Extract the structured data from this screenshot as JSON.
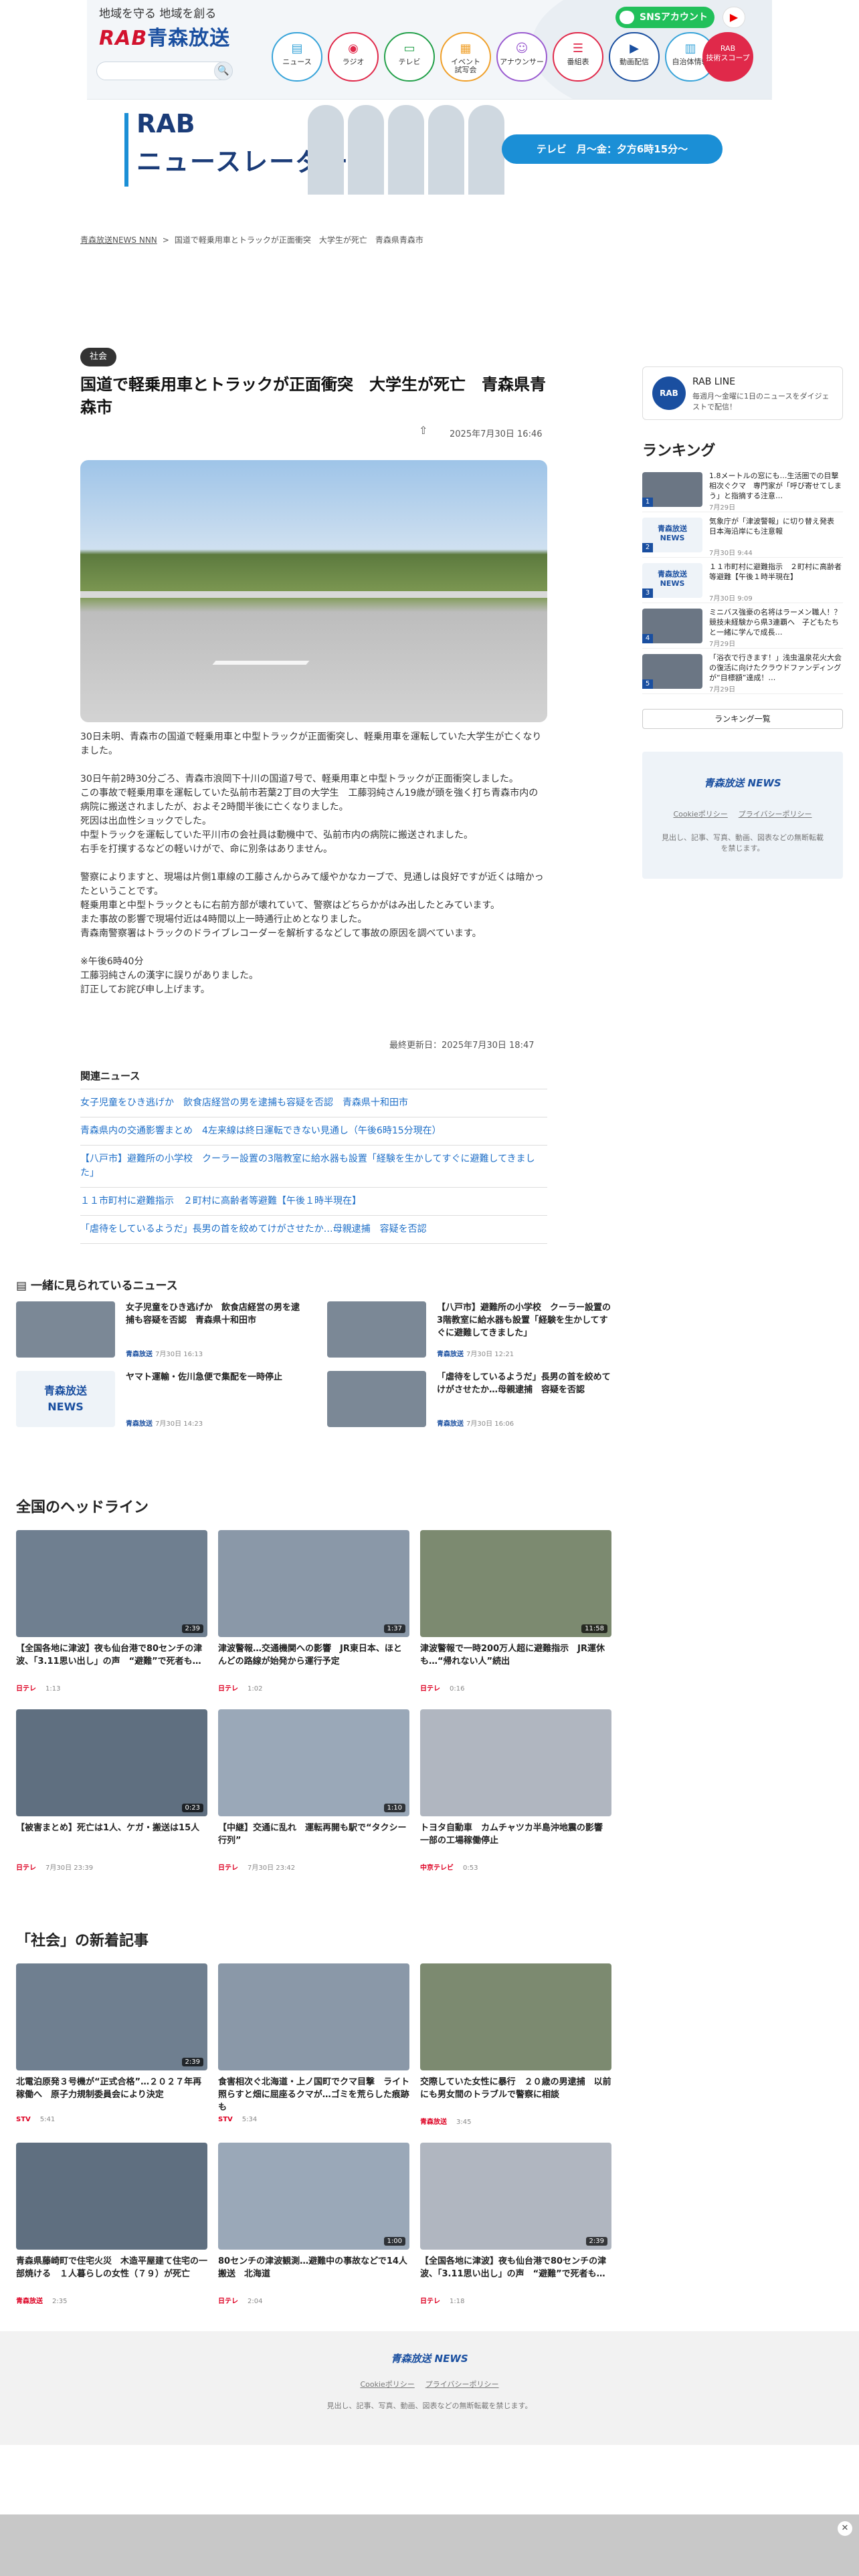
{
  "header": {
    "tagline": "地域を守る 地域を創る",
    "logo_rab": "RAB",
    "logo_name": "青森放送",
    "search_icon": "search-icon",
    "sns_label": "SNSアカウント",
    "nav": [
      {
        "label": "ニュース",
        "icon": "newspaper-icon"
      },
      {
        "label": "ラジオ",
        "icon": "radio-icon"
      },
      {
        "label": "テレビ",
        "icon": "tv-icon"
      },
      {
        "label": "イベント\n試写会",
        "icon": "calendar-icon"
      },
      {
        "label": "アナウンサー",
        "icon": "person-icon"
      },
      {
        "label": "番組表",
        "icon": "list-icon"
      },
      {
        "label": "動画配信",
        "icon": "video-icon"
      },
      {
        "label": "自治体情報",
        "icon": "building-icon"
      }
    ],
    "nav_special": "RAB\n技術スコープ"
  },
  "banner": {
    "line1": "RAB",
    "line2": "ニュースレーダー",
    "pill": "テレビ　月〜金：夕方6時15分〜"
  },
  "breadcrumb": [
    "青森放送NEWS NNN",
    "国道で軽乗用車とトラックが正面衝突　大学生が死亡　青森県青森市"
  ],
  "article": {
    "category": "社会",
    "title": "国道で軽乗用車とトラックが正面衝突　大学生が死亡　青森県青森市",
    "date": "2025年7月30日 16:46",
    "paragraphs": [
      "30日未明、青森市の国道で軽乗用車と中型トラックが正面衝突し、軽乗用車を運転していた大学生が亡くなりました。",
      "30日午前2時30分ごろ、青森市浪岡下十川の国道7号で、軽乗用車と中型トラックが正面衝突しました。\nこの事故で軽乗用車を運転していた弘前市若葉2丁目の大学生　工藤羽純さん19歳が頭を強く打ち青森市内の病院に搬送されましたが、およそ2時間半後に亡くなりました。\n死因は出血性ショックでした。\n中型トラックを運転していた平川市の会社員は動機中で、弘前市内の病院に搬送されました。\n右手を打撲するなどの軽いけがで、命に別条はありません。",
      "警察によりますと、現場は片側1車線の工藤さんからみて緩やかなカーブで、見通しは良好ですが近くは暗かったということです。\n軽乗用車と中型トラックともに右前方部が壊れていて、警察はどちらかがはみ出したとみています。\nまた事故の影響で現場付近は4時間以上一時通行止めとなりました。\n青森南警察署はトラックのドライブレコーダーを解析するなどして事故の原因を調べています。",
      "※午後6時40分\n工藤羽純さんの漢字に誤りがありました。\n訂正してお詫び申し上げます。"
    ],
    "updated": "最終更新日：2025年7月30日 18:47",
    "related_heading": "関連ニュース",
    "related": [
      "女子児童をひき逃げか　飲食店経営の男を逮捕も容疑を否認　青森県十和田市",
      "青森県内の交通影響まとめ　4左来線は終日運転できない見通し（午後6時15分現在）",
      "【八戸市】避難所の小学校　クーラー設置の3階教室に給水器も設置「経験を生かしてすぐに避難してきました」",
      "１１市町村に避難指示　２町村に高齢者等避難【午後１時半現在】",
      "「虐待をしているようだ」長男の首を絞めてけがさせたか…母親逮捕　容疑を否認"
    ]
  },
  "sidebar": {
    "line_title": "RAB LINE",
    "line_desc": "毎週月〜金曜に1日のニュースをダイジェストで配信！",
    "ranking_heading": "ランキング",
    "ranking": [
      {
        "title": "1.8メートルの窓にも…生活圏での目撃相次ぐクマ　専門家が「呼び寄せてしまう」と指摘する注意…",
        "date": "7月29日"
      },
      {
        "title": "気象庁が「津波警報」に切り替え発表　日本海沿岸にも注意報",
        "date": "7月30日 9:44"
      },
      {
        "title": "１１市町村に避難指示　２町村に高齢者等避難【午後１時半現在】",
        "date": "7月30日 9:09"
      },
      {
        "title": "ミニバス強豪の名将はラーメン職人！？競技未経験から県3連覇へ　子どもたちと一緒に学んで成長…",
        "date": "7月29日"
      },
      {
        "title": "「浴衣で行きます！」浅虫温泉花火大会の復活に向けたクラウドファンディングが“目標額”達成！…",
        "date": "7月29日"
      }
    ],
    "ranking_more": "ランキング一覧",
    "footer_logo": "青森放送 NEWS",
    "footer_links": [
      "Cookieポリシー",
      "プライバシーポリシー"
    ],
    "footer_copy": "見出し、記事、写真、動画、図表などの無断転載を禁じます。"
  },
  "also": {
    "heading": "一緒に見られているニュース",
    "items": [
      {
        "title": "女子児童をひき逃げか　飲食店経営の男を逮捕も容疑を否認　青森県十和田市",
        "src": "青森放送",
        "date": "7月30日 16:13"
      },
      {
        "title": "【八戸市】避難所の小学校　クーラー設置の3階教室に給水器も設置「経験を生かしてすぐに避難してきました」",
        "src": "青森放送",
        "date": "7月30日 12:21"
      },
      {
        "title": "ヤマト運輸・佐川急便で集配を一時停止",
        "src": "青森放送",
        "date": "7月30日 14:23"
      },
      {
        "title": "「虐待をしているようだ」長男の首を絞めてけがさせたか…母親逮捕　容疑を否認",
        "src": "青森放送",
        "date": "7月30日 16:06"
      }
    ]
  },
  "headlines": {
    "heading": "全国のヘッドライン",
    "items": [
      {
        "title": "【全国各地に津波】夜も仙台港で80センチの津波、「3.11思い出し」の声　“避難”で死者も…",
        "src": "日テレ",
        "date": "1:13",
        "dur": "2:39"
      },
      {
        "title": "津波警報…交通機関への影響　JR東日本、ほとんどの路線が始発から運行予定",
        "src": "日テレ",
        "date": "1:02",
        "dur": "1:37"
      },
      {
        "title": "津波警報で一時200万人超に避難指示　JR運休も…“帰れない人”続出",
        "src": "日テレ",
        "date": "0:16",
        "dur": "11:58"
      },
      {
        "title": "【被害まとめ】死亡は1人、ケガ・搬送は15人",
        "src": "日テレ",
        "date": "7月30日 23:39",
        "dur": "0:23"
      },
      {
        "title": "【中継】交通に乱れ　運転再開も駅で“タクシー行列”",
        "src": "日テレ",
        "date": "7月30日 23:42",
        "dur": "1:10"
      },
      {
        "title": "トヨタ自動車　カムチャツカ半島沖地震の影響　一部の工場稼働停止",
        "src": "中京テレビ",
        "date": "0:53",
        "dur": ""
      }
    ]
  },
  "social": {
    "heading": "「社会」の新着記事",
    "items": [
      {
        "title": "北電泊原発３号機が“正式合格”…２０２７年再稼働へ　原子力規制委員会により決定",
        "src": "STV",
        "date": "5:41",
        "dur": "2:39"
      },
      {
        "title": "食害相次ぐ北海道・上ノ国町でクマ目撃　ライト照らすと畑に屈座るクマが…ゴミを荒らした痕跡も",
        "src": "STV",
        "date": "5:34",
        "dur": ""
      },
      {
        "title": "交際していた女性に暴行　２０歳の男逮捕　以前にも男女間のトラブルで警察に相談",
        "src": "青森放送",
        "date": "3:45",
        "dur": ""
      },
      {
        "title": "青森県藤崎町で住宅火災　木造平屋建て住宅の一部焼ける　１人暮らしの女性（７９）が死亡",
        "src": "青森放送",
        "date": "2:35",
        "dur": ""
      },
      {
        "title": "80センチの津波観測…避難中の事故などで14人搬送　北海道",
        "src": "日テレ",
        "date": "2:04",
        "dur": "1:00"
      },
      {
        "title": "【全国各地に津波】夜も仙台港で80センチの津波、「3.11思い出し」の声　“避難”で死者も…",
        "src": "日テレ",
        "date": "1:18",
        "dur": "2:39"
      }
    ]
  },
  "footer": {
    "logo": "青森放送 NEWS",
    "links": [
      "Cookieポリシー",
      "プライバシーポリシー"
    ],
    "copy": "見出し、記事、写真、動画、図表などの無断転載を禁じます。"
  }
}
